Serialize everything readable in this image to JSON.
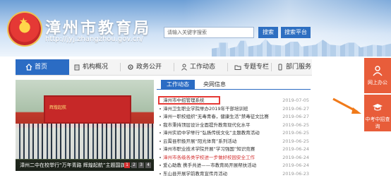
{
  "header": {
    "site_title": "漳州市教育局",
    "site_url": "http://jyj.zhangzhou.gov.cn/",
    "search": {
      "placeholder": "请输入关键字搜索",
      "button": "搜索",
      "platform_button": "搜索平台"
    }
  },
  "nav": {
    "items": [
      {
        "label": "首页",
        "icon": "home-icon",
        "active": true
      },
      {
        "label": "机构概况",
        "icon": "building-icon",
        "active": false
      },
      {
        "label": "政务公开",
        "icon": "gear-icon",
        "active": false
      },
      {
        "label": "工作动态",
        "icon": "person-icon",
        "active": false
      },
      {
        "label": "专题专栏",
        "icon": "folder-icon",
        "active": false
      },
      {
        "label": "部门服务",
        "icon": "phone-icon",
        "active": false
      }
    ]
  },
  "slideshow": {
    "caption": "漳州二中在校举行“万年青路 辉煌起航”主题国旗下...",
    "stage_text": "辉煌起航",
    "pages": [
      "1",
      "2",
      "3",
      "4"
    ]
  },
  "news": {
    "tabs": [
      "工作动态",
      "央网信息"
    ],
    "items": [
      {
        "title": "漳州市中招管理系统",
        "date": "2019-07-05",
        "highlight": true
      },
      {
        "title": "漳州卫生职业学院举办2019年干部培训班",
        "date": "2019-06-27"
      },
      {
        "title": "漳州一职校组织“无毒青春，健康生活”禁毒征文比赛",
        "date": "2019-06-27"
      },
      {
        "title": "我市秉持顶层设计全面提升教育现代化水平",
        "date": "2019-06-25"
      },
      {
        "title": "漳州实验中学举行“弘扬传统文化”主题教育活动",
        "date": "2019-06-25"
      },
      {
        "title": "云霄县积极开展“阳光体育”系列活动",
        "date": "2019-06-25"
      },
      {
        "title": "漳州市职业技术学院开展“学习强国”知识竞赛",
        "date": "2019-06-24"
      },
      {
        "title": "漳州市各级各类学校进一步做好校园安全工作",
        "date": "2019-06-24",
        "red": true
      },
      {
        "title": "爱心助教 携手共进——市教育局开展帮扶活动",
        "date": "2019-06-24"
      },
      {
        "title": "东山县开展学前教育宣传月活动",
        "date": "2019-06-23"
      }
    ]
  },
  "side_widgets": {
    "service": "网上办公",
    "exam": "中考中招查询"
  },
  "colors": {
    "primary": "#2b6cc4",
    "accent": "#e85d3a",
    "highlight": "#e53935"
  }
}
